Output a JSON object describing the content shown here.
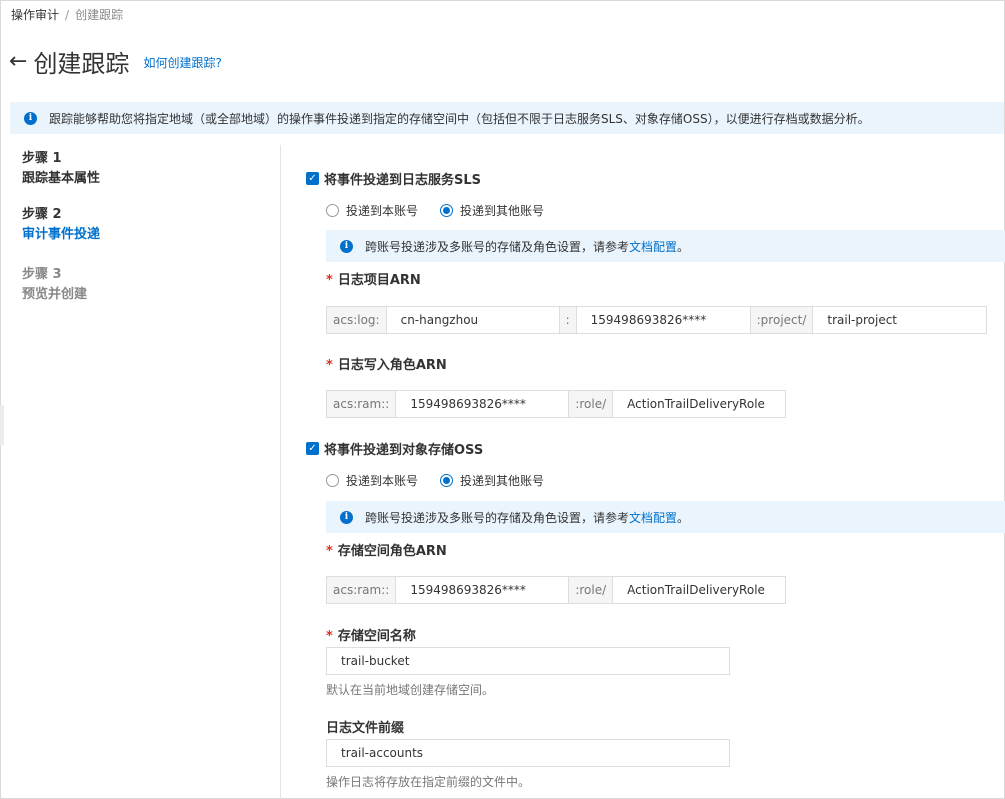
{
  "breadcrumb": {
    "parent": "操作审计",
    "separator": "/",
    "current": "创建跟踪"
  },
  "header": {
    "back_icon": "←",
    "title": "创建跟踪",
    "help_link": "如何创建跟踪?"
  },
  "banner": {
    "text": "跟踪能够帮助您将指定地域（或全部地域）的操作事件投递到指定的存储空间中（包括但不限于日志服务SLS、对象存储OSS），以便进行存档或数据分析。"
  },
  "steps": [
    {
      "num": "步骤 1",
      "name": "跟踪基本属性"
    },
    {
      "num": "步骤 2",
      "name": "审计事件投递"
    },
    {
      "num": "步骤 3",
      "name": "预览并创建"
    }
  ],
  "sls": {
    "checkbox_label": "将事件投递到日志服务SLS",
    "radio_self": "投递到本账号",
    "radio_other": "投递到其他账号",
    "tip_text": "跨账号投递涉及多账号的存储及角色设置，请参考",
    "tip_link": "文档配置",
    "tip_end": "。",
    "project_label": "日志项目ARN",
    "project_prefix": "acs:log:",
    "project_region": "cn-hangzhou",
    "project_colon": ":",
    "project_account": "159498693826****",
    "project_mid": ":project/",
    "project_name": "trail-project",
    "role_label": "日志写入角色ARN",
    "role_prefix": "acs:ram::",
    "role_account": "159498693826****",
    "role_mid": ":role/",
    "role_name": "ActionTrailDeliveryRole"
  },
  "oss": {
    "checkbox_label": "将事件投递到对象存储OSS",
    "radio_self": "投递到本账号",
    "radio_other": "投递到其他账号",
    "tip_text": "跨账号投递涉及多账号的存储及角色设置，请参考",
    "tip_link": "文档配置",
    "tip_end": "。",
    "role_label": "存储空间角色ARN",
    "role_prefix": "acs:ram::",
    "role_account": "159498693826****",
    "role_mid": ":role/",
    "role_name": "ActionTrailDeliveryRole",
    "bucket_label": "存储空间名称",
    "bucket_value": "trail-bucket",
    "bucket_hint": "默认在当前地域创建存储空间。",
    "prefix_label": "日志文件前缀",
    "prefix_value": "trail-accounts",
    "prefix_hint": "操作日志将存放在指定前缀的文件中。"
  },
  "info_icon": "i",
  "check_mark": "✓",
  "required_mark": "*"
}
